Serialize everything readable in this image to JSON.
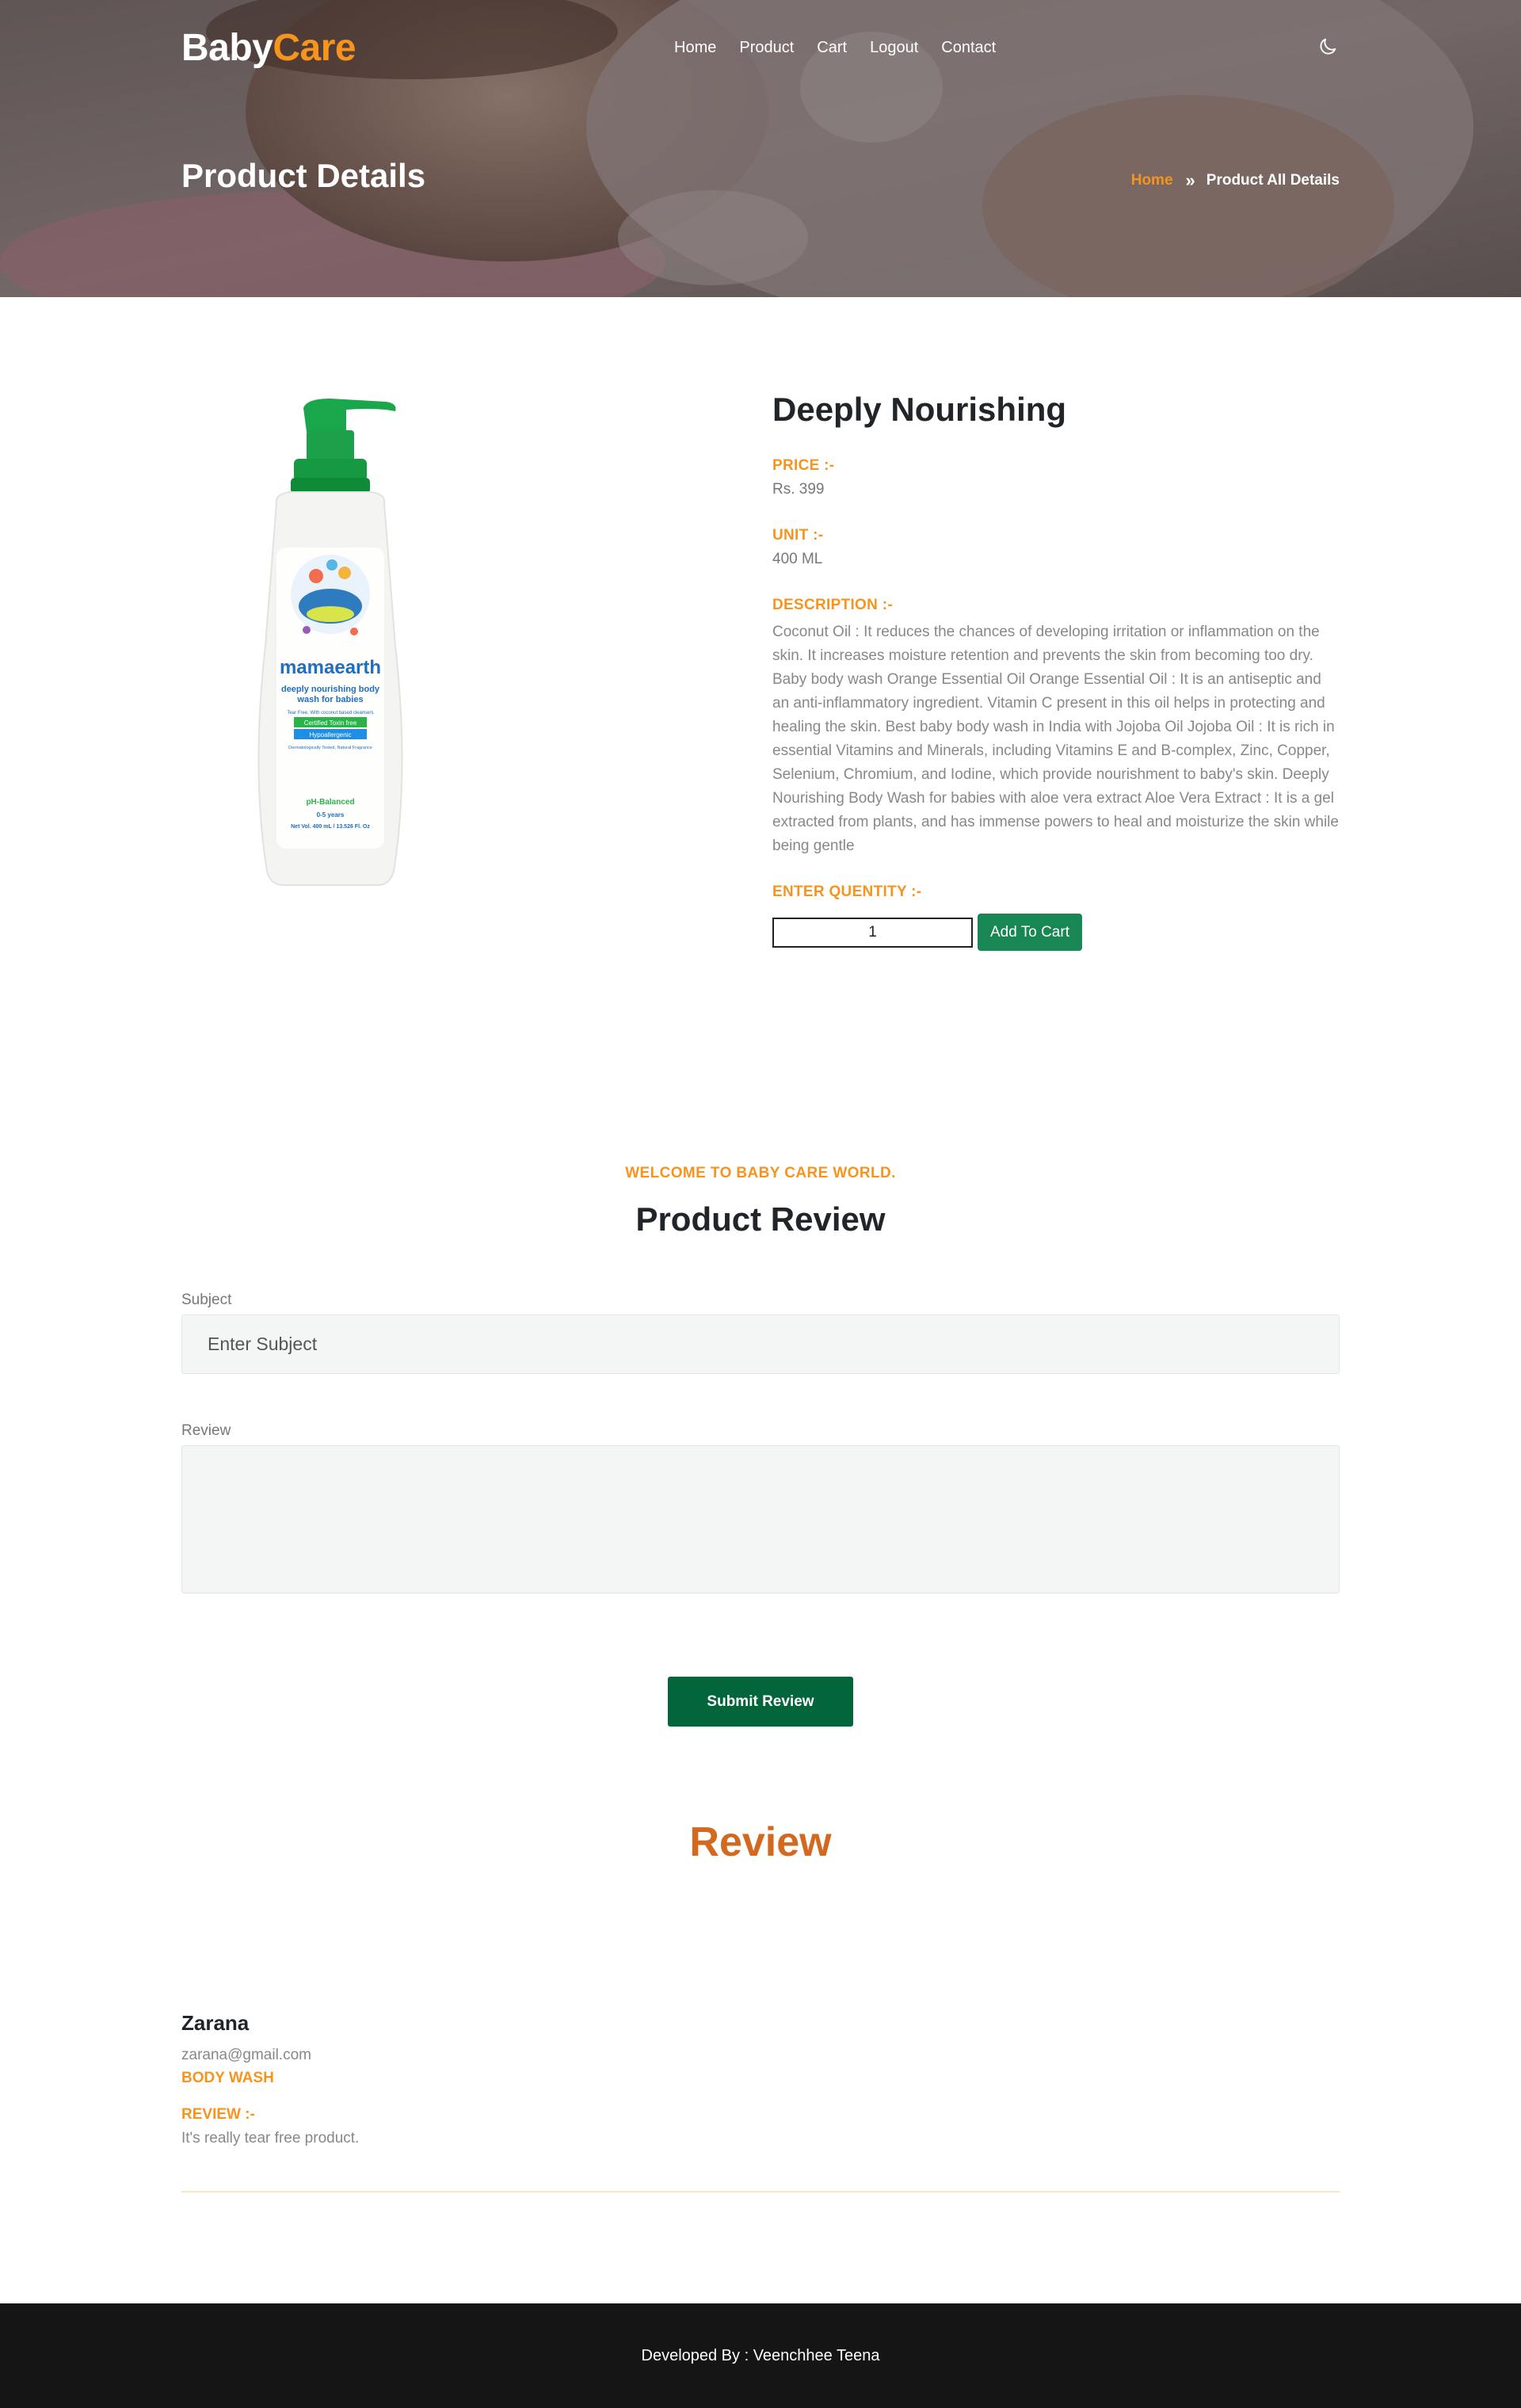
{
  "brand": {
    "part1": "Baby",
    "part2": "Care"
  },
  "nav": {
    "items": [
      "Home",
      "Product",
      "Cart",
      "Logout",
      "Contact"
    ]
  },
  "theme_toggle_icon": "moon-icon",
  "hero": {
    "title": "Product Details",
    "breadcrumb": {
      "home": "Home",
      "separator": "»",
      "current": "Product All Details"
    }
  },
  "product": {
    "name": "Deeply Nourishing",
    "price_label": "PRICE :-",
    "price": "Rs. 399",
    "unit_label": "UNIT :-",
    "unit": "400 ML",
    "description_label": "DESCRIPTION :-",
    "description": "Coconut Oil : It reduces the chances of developing irritation or inflammation on the skin. It increases moisture retention and prevents the skin from becoming too dry. Baby body wash Orange Essential Oil Orange Essential Oil : It is an antiseptic and an anti-inflammatory ingredient. Vitamin C present in this oil helps in protecting and healing the skin. Best baby body wash in India with Jojoba Oil Jojoba Oil : It is rich in essential Vitamins and Minerals, including Vitamins E and B-complex, Zinc, Copper, Selenium, Chromium, and Iodine, which provide nourishment to baby's skin. Deeply Nourishing Body Wash for babies with aloe vera extract Aloe Vera Extract : It is a gel extracted from plants, and has immense powers to heal and moisturize the skin while being gentle",
    "quantity_label": "ENTER QUENTITY :-",
    "quantity_value": "1",
    "add_to_cart": "Add To Cart",
    "image_text": {
      "brand": "mamaearth",
      "line1": "deeply nourishing body",
      "line2": "wash for babies",
      "tag_small": "Tear Free, With coconut based cleansers",
      "badge1": "Certified Toxin free",
      "badge2": "Hypoallergenic",
      "tag_small2": "Dermatologically Tested, Natural Fragrance",
      "ph": "pH-Balanced",
      "age": "0-5 years",
      "volume": "Net Vol. 400 mL / 13.526 Fl. Oz"
    },
    "colors": {
      "cap": "#1aa64a",
      "bottle": "#f4f4f2"
    }
  },
  "review_form": {
    "tagline": "WELCOME TO BABY CARE WORLD.",
    "heading": "Product Review",
    "subject_label": "Subject",
    "subject_placeholder": "Enter Subject",
    "review_label": "Review",
    "review_value": "",
    "submit": "Submit Review"
  },
  "reviews": {
    "title": "Review",
    "items": [
      {
        "name": "Zarana",
        "email": "zarana@gmail.com",
        "product": "BODY WASH",
        "review_label": "REVIEW :-",
        "text": "It's really tear free product."
      }
    ]
  },
  "footer": {
    "text": "Developed By : Veenchhee Teena"
  },
  "colors": {
    "accent": "#f7941d",
    "primary_button": "#198754",
    "submit_button": "#03663a",
    "review_title": "#d2691e",
    "footer_bg": "#151515"
  }
}
